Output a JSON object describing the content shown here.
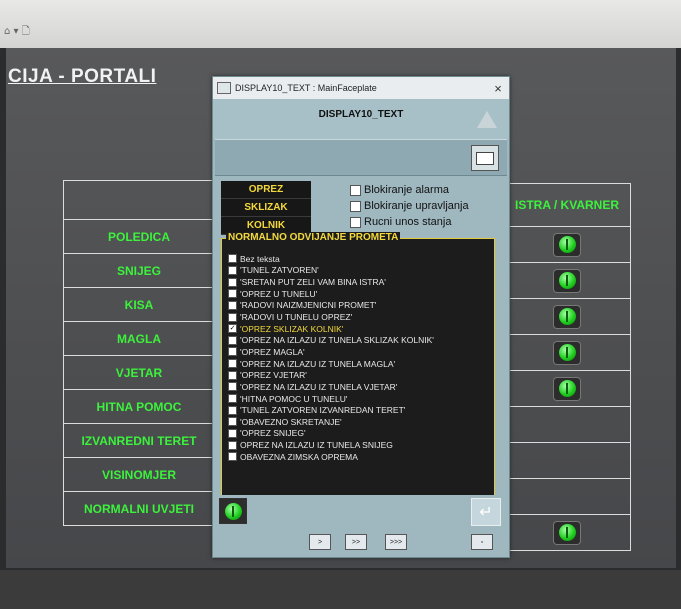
{
  "screen": {
    "title": "CIJA - PORTALI",
    "toolbar_icons": "⌂ ▾ 🗋"
  },
  "left_labels": [
    "",
    "POLEDICA",
    "SNIJEG",
    "KISA",
    "MAGLA",
    "VJETAR",
    "HITNA POMOC",
    "IZVANREDNI TERET",
    "VISINOMJER",
    "NORMALNI UVJETI"
  ],
  "right_table": {
    "header": "ISTRA / KVARNER",
    "rows": [
      true,
      true,
      true,
      true,
      true,
      false,
      false,
      false,
      true
    ]
  },
  "dialog": {
    "window_title": "DISPLAY10_TEXT : MainFaceplate",
    "close_label": "×",
    "name": "DISPLAY10_TEXT",
    "flags": [
      "OPREZ",
      "SKLIZAK",
      "KOLNIK"
    ],
    "options": [
      {
        "label": "Blokiranje alarma",
        "checked": false
      },
      {
        "label": "Blokiranje upravljanja",
        "checked": false
      },
      {
        "label": "Rucni unos stanja",
        "checked": false
      }
    ],
    "list_title": "NORMALNO ODVIJANJE PROMETA",
    "messages": [
      {
        "text": "Bez teksta",
        "checked": false
      },
      {
        "text": "'TUNEL ZATVOREN'",
        "checked": false
      },
      {
        "text": "'SRETAN PUT ZELI VAM BINA ISTRA'",
        "checked": false
      },
      {
        "text": "'OPREZ U TUNELU'",
        "checked": false
      },
      {
        "text": "'RADOVI NAIZMJENICNI PROMET'",
        "checked": false
      },
      {
        "text": "'RADOVI U TUNELU OPREZ'",
        "checked": false
      },
      {
        "text": "'OPREZ SKLIZAK KOLNIK'",
        "checked": true
      },
      {
        "text": "'OPREZ NA IZLAZU IZ TUNELA SKLIZAK KOLNIK'",
        "checked": false
      },
      {
        "text": "'OPREZ MAGLA'",
        "checked": false
      },
      {
        "text": "'OPREZ NA IZLAZU IZ TUNELA MAGLA'",
        "checked": false
      },
      {
        "text": "'OPREZ VJETAR'",
        "checked": false
      },
      {
        "text": "'OPREZ NA IZLAZU IZ TUNELA VJETAR'",
        "checked": false
      },
      {
        "text": "'HITNA POMOC U TUNELU'",
        "checked": false
      },
      {
        "text": "'TUNEL ZATVOREN IZVANREDAN TERET'",
        "checked": false
      },
      {
        "text": "'OBAVEZNO SKRETANJE'",
        "checked": false
      },
      {
        "text": "'OPREZ SNIJEG'",
        "checked": false
      },
      {
        "text": "OPREZ NA IZLAZU IZ TUNELA SNIJEG",
        "checked": false
      },
      {
        "text": "OBAVEZNA ZIMSKA OPREMA",
        "checked": false
      }
    ],
    "enter_label": "↵",
    "nav_buttons": [
      ">",
      ">>",
      ">>>"
    ],
    "corner_button": "▫"
  }
}
